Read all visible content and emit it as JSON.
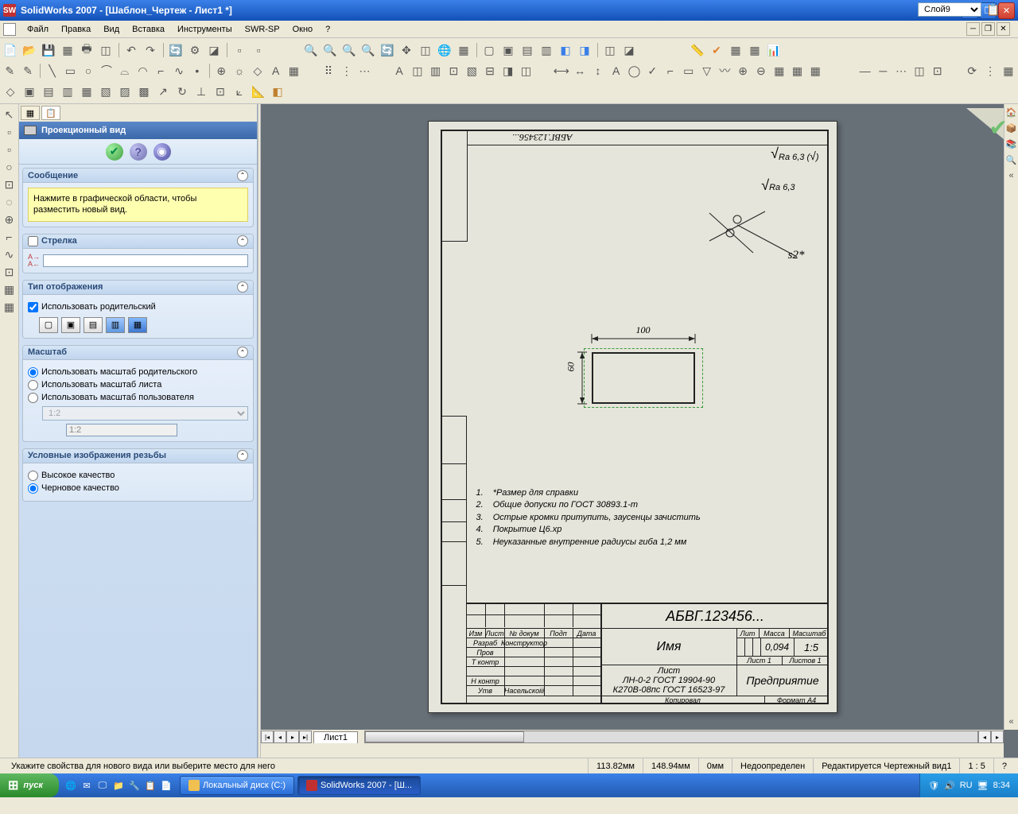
{
  "title": "SolidWorks 2007 - [Шаблон_Чертеж - Лист1 *]",
  "menu": [
    "Файл",
    "Правка",
    "Вид",
    "Вставка",
    "Инструменты",
    "SWR-SP",
    "Окно",
    "?"
  ],
  "layer": "Слой9",
  "panel": {
    "title": "Проекционный вид",
    "msg_title": "Сообщение",
    "msg_text": "Нажмите в графической области, чтобы разместить новый вид.",
    "arrow_title": "Стрелка",
    "arrow_value": "",
    "disp_title": "Тип отображения",
    "disp_use_parent": "Использовать родительский",
    "scale_title": "Масштаб",
    "scale_opts": [
      "Использовать масштаб родительского",
      "Использовать масштаб листа",
      "Использовать масштаб пользователя"
    ],
    "scale_dropdown": "1:2",
    "scale_input": "1:2",
    "thread_title": "Условные изображения резьбы",
    "thread_opts": [
      "Высокое качество",
      "Черновое качество"
    ]
  },
  "drawing": {
    "top_code": "АБВГ.123456...",
    "ra_text1": "Ra 6,3 (",
    "ra_text2": "Ra 6,3",
    "s2": "s2*",
    "dim_w": "100",
    "dim_h": "60",
    "notes": [
      [
        "1.",
        "*Размер для справки"
      ],
      [
        "2.",
        "Общие допуски по ГОСТ 30893.1-m"
      ],
      [
        "3.",
        "Острые кромки притупить, заусенцы зачистить"
      ],
      [
        "4.",
        "Покрытие Ц6.хр"
      ],
      [
        "5.",
        "Неуказанные внутренние радиусы гиба 1,2 мм"
      ]
    ],
    "tb_main": "АБВГ.123456...",
    "tb_name": "Имя",
    "tb_mass": "0,094",
    "tb_scale": "1:5",
    "tb_ent": "Предприятие",
    "tb_line1": "ЛН-0-2 ГОСТ 19904-90",
    "tb_line2": "К270В-08пс ГОСТ 16523-97",
    "tb_sheet": "Лист 1",
    "tb_sheets": "Листов 1",
    "tb_roles": [
      "Разраб",
      "Пров",
      "Т контр",
      "",
      "Н контр",
      "Утв"
    ],
    "tb_constructor": "Конструктор",
    "tb_hdrs": [
      "Изм",
      "Лист",
      "№ докум",
      "Подп",
      "Дата"
    ],
    "tb_head3": [
      "Лит",
      "Масса",
      "Масштаб"
    ],
    "tb_list_lbl": "Лист",
    "tb_copied": "Копировал",
    "tb_format": "Формат А4",
    "tb_arts_lbl": "Насельскoiii"
  },
  "sheet_tab": "Лист1",
  "status": {
    "msg": "Укажите свойства для нового вида или выберите место для него",
    "x": "113.82мм",
    "y": "148.94мм",
    "z": "0мм",
    "state": "Недоопределен",
    "editing": "Редактируется Чертежный вид1",
    "ratio": "1 : 5"
  },
  "taskbar": {
    "start": "пуск",
    "tasks": [
      "Локальный диск (C:)",
      "SolidWorks 2007 - [Ш..."
    ],
    "lang": "RU",
    "time": "8:34"
  }
}
